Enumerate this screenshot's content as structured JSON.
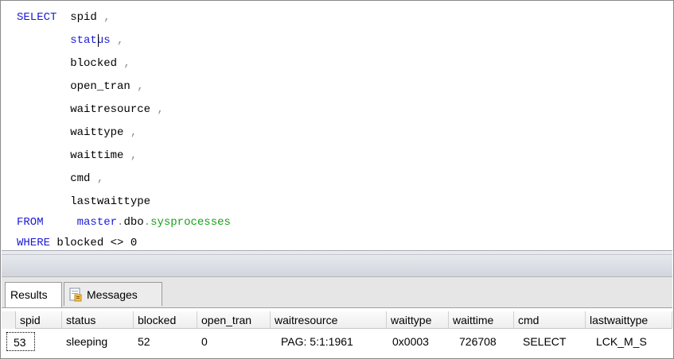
{
  "editor": {
    "lines": [
      {
        "kw": "SELECT",
        "text": "  spid",
        "punct": " ,"
      },
      {
        "kw": "",
        "text": "        status",
        "punct": " ,"
      },
      {
        "kw": "",
        "text": "        blocked",
        "punct": " ,"
      },
      {
        "kw": "",
        "text": "        open_tran",
        "punct": " ,"
      },
      {
        "kw": "",
        "text": "        waitresource",
        "punct": " ,"
      },
      {
        "kw": "",
        "text": "        waittype",
        "punct": " ,"
      },
      {
        "kw": "",
        "text": "        waittime",
        "punct": " ,"
      },
      {
        "kw": "",
        "text": "        cmd",
        "punct": " ,"
      },
      {
        "kw": "",
        "text": "        lastwaittype",
        "punct": ""
      }
    ],
    "from_kw": "FROM",
    "from_db": "master",
    "from_dot1": ".",
    "from_schema": "dbo",
    "from_dot2": ".",
    "from_table": "sysprocesses",
    "where_kw": "WHERE",
    "where_rest": " blocked <> 0",
    "colors": {
      "keyword": "#1a1ad8",
      "system_object": "#17a017",
      "punctuation": "#8c8c8c"
    }
  },
  "tabs": [
    {
      "label": "Results",
      "active": true
    },
    {
      "label": "Messages",
      "active": false,
      "icon": "messages-icon"
    }
  ],
  "results": {
    "columns": [
      "spid",
      "status",
      "blocked",
      "open_tran",
      "waitresource",
      "waittype",
      "waittime",
      "cmd",
      "lastwaittype"
    ],
    "rows": [
      [
        "53",
        "sleeping",
        "52",
        "0",
        "PAG: 5:1:1961",
        "0x0003",
        "726708",
        "SELECT",
        "LCK_M_S"
      ]
    ]
  }
}
